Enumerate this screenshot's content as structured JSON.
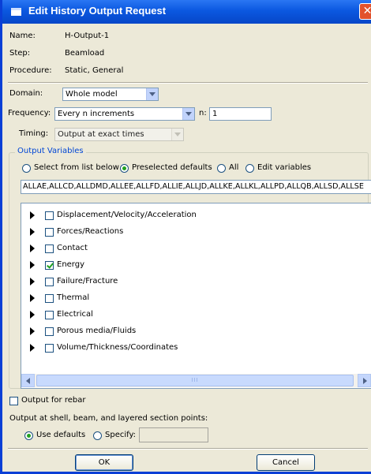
{
  "window": {
    "title": "Edit History Output Request",
    "close_glyph": "✕"
  },
  "info": {
    "name_label": "Name:",
    "name_value": "H-Output-1",
    "step_label": "Step:",
    "step_value": "Beamload",
    "procedure_label": "Procedure:",
    "procedure_value": "Static, General"
  },
  "domain": {
    "label": "Domain:",
    "value": "Whole model"
  },
  "frequency": {
    "label": "Frequency:",
    "value": "Every n increments",
    "n_label": "n:",
    "n_value": "1"
  },
  "timing": {
    "label": "Timing:",
    "value": "Output at exact times"
  },
  "output_variables": {
    "title": "Output Variables",
    "options": [
      {
        "label": "Select from list below",
        "selected": false
      },
      {
        "label": "Preselected defaults",
        "selected": true
      },
      {
        "label": "All",
        "selected": false
      },
      {
        "label": "Edit variables",
        "selected": false
      }
    ],
    "variables_text": "ALLAE,ALLCD,ALLDMD,ALLEE,ALLFD,ALLIE,ALLJD,ALLKE,ALLKL,ALLPD,ALLQB,ALLSD,ALLSE",
    "categories": [
      {
        "label": "Displacement/Velocity/Acceleration",
        "checked": false
      },
      {
        "label": "Forces/Reactions",
        "checked": false
      },
      {
        "label": "Contact",
        "checked": false
      },
      {
        "label": "Energy",
        "checked": true
      },
      {
        "label": "Failure/Fracture",
        "checked": false
      },
      {
        "label": "Thermal",
        "checked": false
      },
      {
        "label": "Electrical",
        "checked": false
      },
      {
        "label": "Porous media/Fluids",
        "checked": false
      },
      {
        "label": "Volume/Thickness/Coordinates",
        "checked": false
      }
    ],
    "scroll_grip": "III"
  },
  "rebar": {
    "label": "Output for rebar",
    "checked": false
  },
  "section_points": {
    "label": "Output at shell, beam, and layered section points:",
    "use_defaults_label": "Use defaults",
    "use_defaults_selected": true,
    "specify_label": "Specify:",
    "specify_value": ""
  },
  "buttons": {
    "ok": "OK",
    "cancel": "Cancel"
  }
}
